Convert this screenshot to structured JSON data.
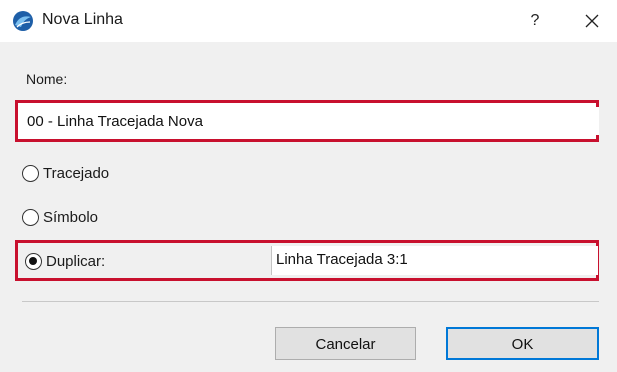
{
  "window": {
    "title": "Nova Linha",
    "icon": "archicad-logo-icon",
    "help_label": "?",
    "close_icon": "close-icon"
  },
  "form": {
    "name_label": "Nome:",
    "name_value": "00 - Linha Tracejada Nova",
    "options": [
      {
        "label": "Tracejado",
        "selected": false
      },
      {
        "label": "Símbolo",
        "selected": false
      },
      {
        "label": "Duplicar:",
        "selected": true
      }
    ],
    "duplicate_source": "Linha Tracejada 3:1"
  },
  "buttons": {
    "cancel_label": "Cancelar",
    "ok_label": "OK"
  },
  "colors": {
    "highlight_border": "#c8102e",
    "default_button_border": "#0078d7"
  }
}
